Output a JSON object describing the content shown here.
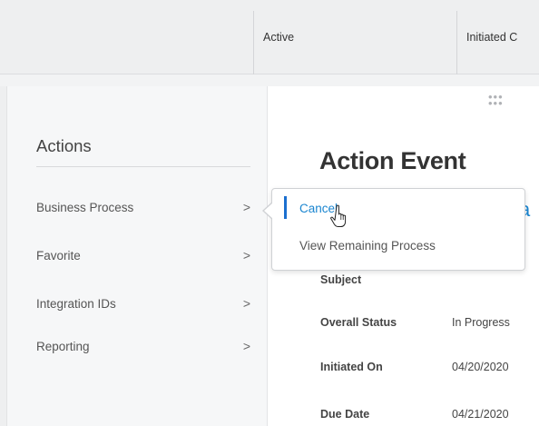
{
  "table_header": {
    "columns": [
      "Active",
      "Initiated C"
    ]
  },
  "actions": {
    "title": "Actions",
    "items": [
      {
        "label": "Business Process",
        "chevron": ">"
      },
      {
        "label": "Favorite",
        "chevron": ">"
      },
      {
        "label": "Integration IDs",
        "chevron": ">"
      },
      {
        "label": "Reporting",
        "chevron": ">"
      }
    ]
  },
  "submenu": {
    "items": [
      {
        "label": "Cancel",
        "selected": true
      },
      {
        "label": "View Remaining Process",
        "selected": false
      }
    ]
  },
  "event": {
    "title": "Action Event",
    "partial_heading": "a",
    "fields": [
      {
        "label": "Subject",
        "value": ""
      },
      {
        "label": "Overall Status",
        "value": "In Progress"
      },
      {
        "label": "Initiated On",
        "value": "04/20/2020"
      },
      {
        "label": "Due Date",
        "value": "04/21/2020"
      }
    ]
  },
  "icons": {
    "drag_handle": "drag-dots-icon",
    "cursor": "hand-pointer-icon",
    "chevron": "chevron-right-icon"
  },
  "colors": {
    "accent": "#1b86d0",
    "selected_bar": "#1b6fcf",
    "panel_bg": "#f6f7f8",
    "header_bg": "#eeeff0"
  }
}
